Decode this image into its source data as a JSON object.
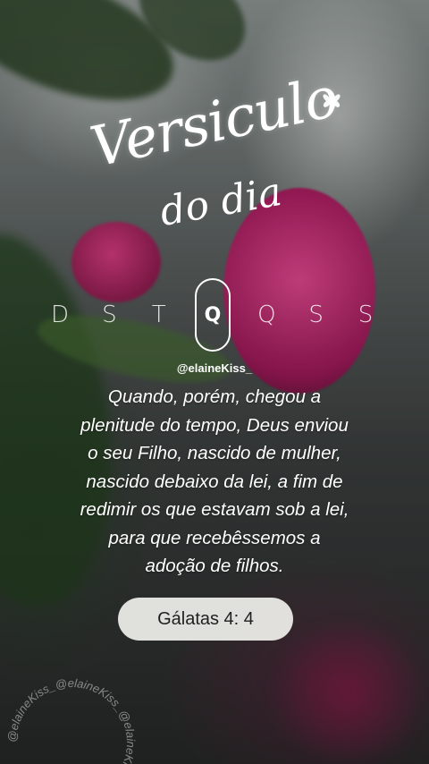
{
  "title": {
    "line1": "Versiculo",
    "line2": "do dia",
    "ornament_icon": "butterfly-icon"
  },
  "weekdays": [
    "D",
    "S",
    "T",
    "Q",
    "Q",
    "S",
    "S"
  ],
  "weekday_active_index": 3,
  "handle": "@elaineKiss_",
  "verse": {
    "lines": [
      "Quando, porém, chegou a",
      "plenitude do tempo, Deus enviou",
      "o seu Filho, nascido de mulher,",
      "nascido debaixo da lei, a fim de",
      "redimir os que estavam sob a lei,",
      "para que recebêssemos a",
      "adoção de filhos."
    ]
  },
  "reference": "Gálatas 4: 4",
  "watermark_text": "@elaineKiss_@elaineKiss_@elaineKiss_",
  "colors": {
    "text": "#ffffff",
    "pill_background": "#ecece9",
    "flower_accent": "#c2185b"
  }
}
